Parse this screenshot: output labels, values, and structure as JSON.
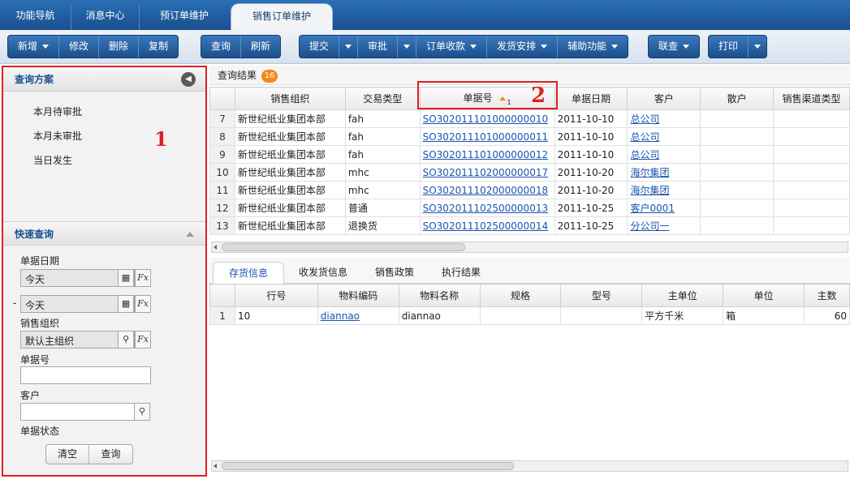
{
  "top_tabs": [
    {
      "label": "功能导航",
      "active": false
    },
    {
      "label": "消息中心",
      "active": false
    },
    {
      "label": "预订单维护",
      "active": false
    },
    {
      "label": "销售订单维护",
      "active": true
    }
  ],
  "toolbar": {
    "groups": [
      [
        {
          "label": "新增",
          "dropdown": true
        },
        {
          "label": "修改"
        },
        {
          "label": "删除"
        },
        {
          "label": "复制"
        }
      ],
      [
        {
          "label": "查询"
        },
        {
          "label": "刷新"
        }
      ],
      [
        {
          "label": "提交",
          "split": true
        },
        {
          "label": "审批",
          "split": true
        },
        {
          "label": "订单收款",
          "dropdown": true
        },
        {
          "label": "发货安排",
          "dropdown": true
        },
        {
          "label": "辅助功能",
          "dropdown": true
        }
      ],
      [
        {
          "label": "联查",
          "dropdown": true
        }
      ],
      [
        {
          "label": "打印",
          "split": true
        }
      ]
    ]
  },
  "left_panel": {
    "scheme_title": "查询方案",
    "schemes": [
      "本月待审批",
      "本月未审批",
      "当日发生"
    ],
    "marker_1": "1",
    "quick_title": "快速查询",
    "fields": {
      "doc_date_label": "单据日期",
      "date_from": "今天",
      "date_to": "今天",
      "range_dash": "-",
      "org_label": "销售组织",
      "org_value": "默认主组织",
      "doc_no_label": "单据号",
      "customer_label": "客户",
      "status_label": "单据状态"
    },
    "fx_label": "Fx",
    "clear_label": "清空",
    "query_label": "查询"
  },
  "results": {
    "label": "查询结果",
    "count": "16",
    "marker_2": "2",
    "sort_rank": "1",
    "columns": [
      "",
      "销售组织",
      "交易类型",
      "单据号",
      "单据日期",
      "客户",
      "散户",
      "销售渠道类型"
    ],
    "rows": [
      {
        "n": "7",
        "org": "新世纪纸业集团本部",
        "type": "fah",
        "no": "SO302011101000000010",
        "date": "2011-10-10",
        "cust": "总公司"
      },
      {
        "n": "8",
        "org": "新世纪纸业集团本部",
        "type": "fah",
        "no": "SO302011101000000011",
        "date": "2011-10-10",
        "cust": "总公司"
      },
      {
        "n": "9",
        "org": "新世纪纸业集团本部",
        "type": "fah",
        "no": "SO302011101000000012",
        "date": "2011-10-10",
        "cust": "总公司"
      },
      {
        "n": "10",
        "org": "新世纪纸业集团本部",
        "type": "mhc",
        "no": "SO302011102000000017",
        "date": "2011-10-20",
        "cust": "海尔集团"
      },
      {
        "n": "11",
        "org": "新世纪纸业集团本部",
        "type": "mhc",
        "no": "SO302011102000000018",
        "date": "2011-10-20",
        "cust": "海尔集团"
      },
      {
        "n": "12",
        "org": "新世纪纸业集团本部",
        "type": "普通",
        "no": "SO302011102500000013",
        "date": "2011-10-25",
        "cust": "客户0001"
      },
      {
        "n": "13",
        "org": "新世纪纸业集团本部",
        "type": "退换货",
        "no": "SO302011102500000014",
        "date": "2011-10-25",
        "cust": "分公司一"
      }
    ]
  },
  "bottom_tabs": [
    {
      "label": "存货信息",
      "active": true
    },
    {
      "label": "收发货信息",
      "active": false
    },
    {
      "label": "销售政策",
      "active": false
    },
    {
      "label": "执行结果",
      "active": false
    }
  ],
  "detail": {
    "columns": [
      "",
      "行号",
      "物料编码",
      "物料名称",
      "规格",
      "型号",
      "主单位",
      "单位",
      "主数"
    ],
    "rows": [
      {
        "n": "1",
        "line": "10",
        "code": "diannao",
        "name": "diannao",
        "spec": "",
        "model": "",
        "main_unit": "平方千米",
        "unit": "箱",
        "qty": "60"
      }
    ]
  }
}
